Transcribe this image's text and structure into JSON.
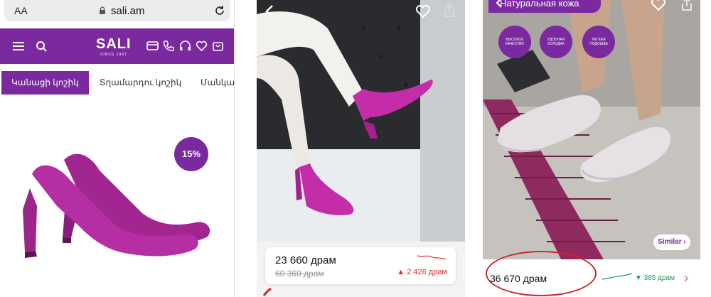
{
  "panel1": {
    "browser": {
      "text_size": "AA",
      "url": "sali.am"
    },
    "logo": {
      "name": "SALI",
      "tagline": "SINCE 1997"
    },
    "categories": [
      "Կանացի կոշիկ",
      "Տղամարդու կոշիկ",
      "Մանկակ"
    ],
    "discount_badge": "15%",
    "icons": [
      "menu-icon",
      "search-icon",
      "card-icon",
      "phone-icon",
      "headset-icon",
      "heart-icon",
      "bag-icon"
    ],
    "brand_color": "#7a2a9e"
  },
  "panel2": {
    "price": "23 660 драм",
    "old_price": "60 360 драм",
    "price_change": "▲ 2 426 драм",
    "change_color": "#e02b2b"
  },
  "panel3": {
    "badge": "Натуральная кожа",
    "features": [
      "Высокое качество",
      "Удобная колодка",
      "Легкая подошва"
    ],
    "similar_label": "Similar ›",
    "price": "36 670 драм",
    "price_change": "▼ 385 драм",
    "change_color": "#1a9e58"
  }
}
